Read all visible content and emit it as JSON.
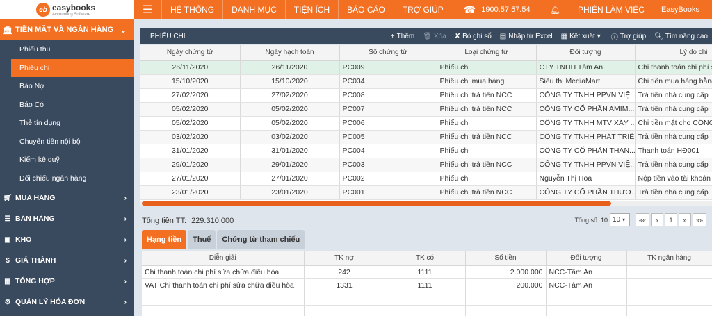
{
  "brand": {
    "logo_mark": "eb",
    "name": "easybooks",
    "tagline": "Accounting Software"
  },
  "topnav": {
    "items": [
      "HỆ THỐNG",
      "DANH MỤC",
      "TIỆN ÍCH",
      "BÁO CÁO",
      "TRỢ GIÚP"
    ],
    "phone": "1900.57.57.54",
    "session": "PHIÊN LÀM VIỆC",
    "user": "EasyBooks"
  },
  "sidebar": {
    "section": "TIỀN MẶT VÀ NGÂN HÀNG",
    "sub_items": [
      "Phiếu thu",
      "Phiếu chi",
      "Báo Nợ",
      "Báo Có",
      "Thẻ tín dụng",
      "Chuyển tiền nội bộ",
      "Kiểm kê quỹ",
      "Đối chiếu ngân hàng"
    ],
    "active_sub": "Phiếu chi",
    "sections": [
      "MUA HÀNG",
      "BÁN HÀNG",
      "KHO",
      "GIÁ THÀNH",
      "TỔNG HỢP",
      "QUẢN LÝ HÓA ĐƠN"
    ]
  },
  "page": {
    "title": "PHIẾU CHI",
    "tools": {
      "add": "Thêm",
      "delete": "Xóa",
      "unpost": "Bỏ ghi sổ",
      "import": "Nhập từ Excel",
      "export": "Kết xuất",
      "help": "Trợ giúp",
      "search": "Tìm nâng cao"
    }
  },
  "grid": {
    "columns": [
      "Ngày chứng từ",
      "Ngày hạch toán",
      "Số chứng từ",
      "Loại chứng từ",
      "Đối tượng",
      "Lý do chi"
    ],
    "rows": [
      [
        "26/11/2020",
        "26/11/2020",
        "PC009",
        "Phiếu chi",
        "CTY TNHH Tâm An",
        "Chi thanh toán chi phí sửa"
      ],
      [
        "15/10/2020",
        "15/10/2020",
        "PC034",
        "Phiếu chi mua hàng",
        "Siêu thị MediaMart",
        "Chi tiền mua hàng bằng"
      ],
      [
        "27/02/2020",
        "27/02/2020",
        "PC008",
        "Phiếu chi trả tiền NCC",
        "CÔNG TY TNHH PPVN VIỆ...",
        "Trả tiền nhà cung cấp"
      ],
      [
        "05/02/2020",
        "05/02/2020",
        "PC007",
        "Phiếu chi trả tiền NCC",
        "CÔNG TY CỔ PHẦN AMIM...",
        "Trả tiền nhà cung cấp"
      ],
      [
        "05/02/2020",
        "05/02/2020",
        "PC006",
        "Phiếu chi",
        "CÔNG TY TNHH MTV XÂY ...",
        "Chi tiền mặt cho CÔNG"
      ],
      [
        "03/02/2020",
        "03/02/2020",
        "PC005",
        "Phiếu chi trả tiền NCC",
        "CÔNG TY TNHH PHÁT TRIỂ...",
        "Trả tiền nhà cung cấp"
      ],
      [
        "31/01/2020",
        "31/01/2020",
        "PC004",
        "Phiếu chi",
        "CÔNG TY CỔ PHẦN THAN...",
        "Thanh toán HĐ001"
      ],
      [
        "29/01/2020",
        "29/01/2020",
        "PC003",
        "Phiếu chi trả tiền NCC",
        "CÔNG TY TNHH PPVN VIỆ...",
        "Trả tiền nhà cung cấp"
      ],
      [
        "27/01/2020",
        "27/01/2020",
        "PC002",
        "Phiếu chi",
        "Nguyễn Thị Hoa",
        "Nộp tiền vào tài khoản"
      ],
      [
        "23/01/2020",
        "23/01/2020",
        "PC001",
        "Phiếu chi trả tiền NCC",
        "CÔNG TY CỔ PHẦN THƯƠ...",
        "Trả tiền nhà cung cấp"
      ]
    ]
  },
  "totals": {
    "label": "Tổng tiền TT:",
    "value": "229.310.000"
  },
  "pager": {
    "count_label": "Tổng số: 10",
    "page_size": "10",
    "first": "««",
    "prev": "«",
    "page": "1",
    "next": "»",
    "last": "»»"
  },
  "tabs": [
    "Hạng tiền",
    "Thuế",
    "Chứng từ tham chiếu"
  ],
  "detail": {
    "columns": [
      "Diễn giải",
      "TK nợ",
      "TK có",
      "Số tiền",
      "Đối tượng",
      "TK ngân hàng"
    ],
    "rows": [
      [
        "Chi thanh toán chi phí sửa chữa điều hòa",
        "242",
        "1111",
        "2.000.000",
        "NCC-Tâm An",
        ""
      ],
      [
        "VAT Chi thanh toán chi phí sửa chữa điều hòa",
        "1331",
        "1111",
        "200.000",
        "NCC-Tâm An",
        ""
      ]
    ]
  }
}
